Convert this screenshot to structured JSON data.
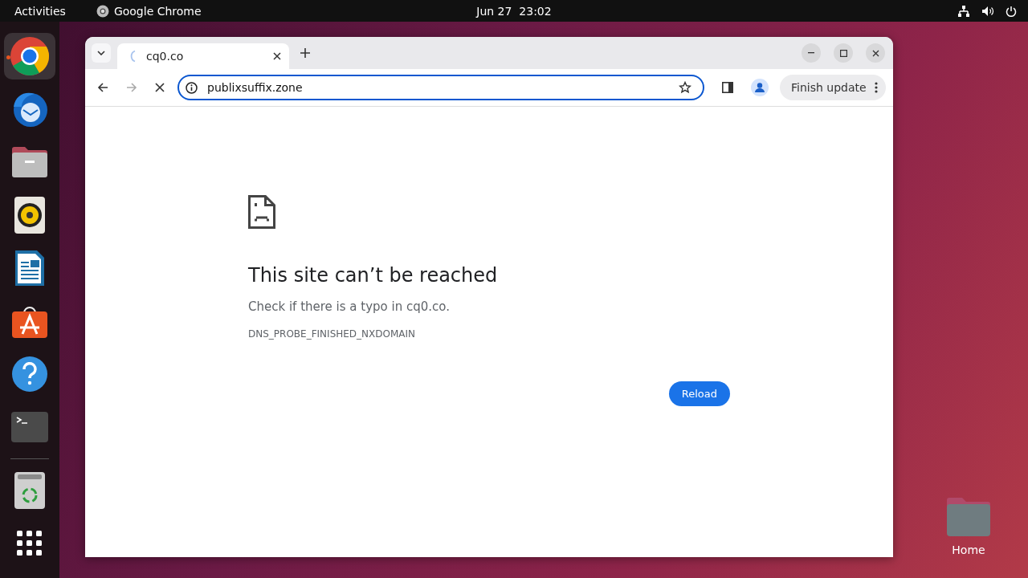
{
  "top_bar": {
    "activities": "Activities",
    "app_name": "Google Chrome",
    "clock": "Jun 27  23:02"
  },
  "dock": {
    "items": [
      {
        "kind": "chrome",
        "running": true
      },
      {
        "kind": "mail",
        "running": false
      },
      {
        "kind": "files",
        "running": false
      },
      {
        "kind": "music",
        "running": false
      },
      {
        "kind": "writer",
        "running": false
      },
      {
        "kind": "store",
        "running": false
      },
      {
        "kind": "help",
        "running": false
      },
      {
        "kind": "terminal",
        "running": false
      },
      {
        "kind": "trash",
        "running": false
      },
      {
        "kind": "apps",
        "running": false
      }
    ]
  },
  "desktop_icons": [
    {
      "label": "Home"
    }
  ],
  "browser": {
    "tabs": [
      {
        "title": "cq0.co",
        "selected": true,
        "loading": true
      }
    ],
    "address": "publixsuffix.zone",
    "loading": true,
    "update_button": "Finish update",
    "error": {
      "title": "This site can’t be reached",
      "message": "Check if there is a typo in cq0.co.",
      "code": "DNS_PROBE_FINISHED_NXDOMAIN",
      "button": "Reload"
    }
  }
}
